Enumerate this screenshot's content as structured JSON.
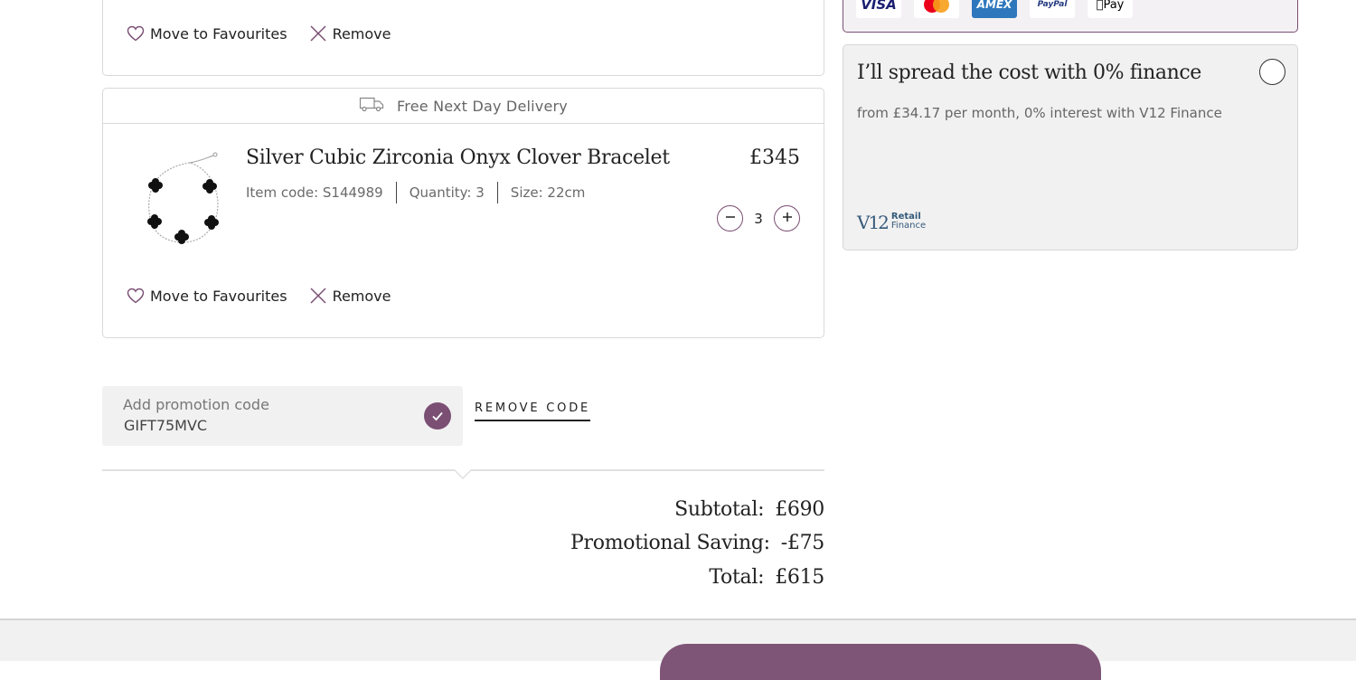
{
  "cart": {
    "top_card": {
      "move_to_favourites": "Move to Favourites",
      "remove": "Remove"
    },
    "item": {
      "delivery": "Free Next Day Delivery",
      "title": "Silver Cubic Zirconia Onyx Clover Bracelet",
      "price": "£345",
      "item_code": "Item code: S144989",
      "quantity_label": "Quantity: 3",
      "size": "Size: 22cm",
      "quantity_value": "3",
      "move_to_favourites": "Move to Favourites",
      "remove": "Remove"
    }
  },
  "promo": {
    "label": "Add promotion code",
    "value": "GIFT75MVC",
    "remove_code": "REMOVE CODE"
  },
  "summary": {
    "subtotal_label": "Subtotal:",
    "subtotal_value": "£690",
    "saving_label": "Promotional Saving:",
    "saving_value": "-£75",
    "total_label": "Total:",
    "total_value": "£615"
  },
  "payment": {
    "logos": [
      "VISA",
      "Mastercard",
      "AMEX",
      "PayPal",
      "Apple Pay"
    ],
    "visa_text": "VISA",
    "amex_text": "AMEX",
    "paypal_text": "PayPal",
    "applepay_text": "Pay"
  },
  "finance": {
    "title": "I’ll spread the cost with 0% finance",
    "subtitle": "from £34.17 per month, 0% interest with V12 Finance",
    "logo_mark": "V12",
    "logo_retail": "Retail",
    "logo_finance": "Finance"
  },
  "colors": {
    "accent": "#7a4f73",
    "button": "#7f5577",
    "panel": "#f1f1f1"
  }
}
